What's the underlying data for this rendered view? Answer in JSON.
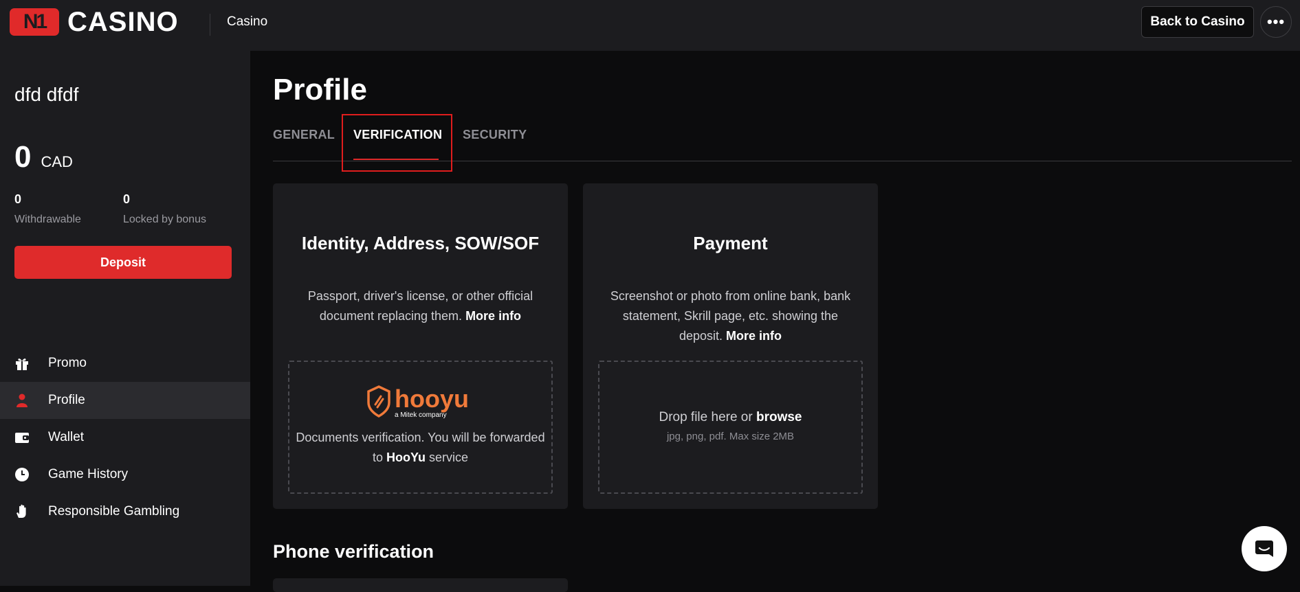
{
  "header": {
    "logo_mark": "N1",
    "logo_text": "CASINO",
    "section": "Casino",
    "back_label": "Back to Casino",
    "more_label": "•••"
  },
  "sidebar": {
    "user_name": "dfd dfdf",
    "balance": "0",
    "currency": "CAD",
    "withdrawable_value": "0",
    "withdrawable_label": "Withdrawable",
    "locked_value": "0",
    "locked_label": "Locked by bonus",
    "deposit_label": "Deposit",
    "nav": [
      {
        "label": "Promo",
        "icon": "gift-icon"
      },
      {
        "label": "Profile",
        "icon": "user-icon",
        "active": true
      },
      {
        "label": "Wallet",
        "icon": "wallet-icon"
      },
      {
        "label": "Game History",
        "icon": "clock-icon"
      },
      {
        "label": "Responsible Gambling",
        "icon": "hand-icon"
      }
    ]
  },
  "main": {
    "title": "Profile",
    "tabs": [
      {
        "label": "GENERAL"
      },
      {
        "label": "VERIFICATION",
        "active": true
      },
      {
        "label": "SECURITY"
      }
    ],
    "cards": [
      {
        "title": "Identity, Address, SOW/SOF",
        "desc": "Passport, driver's license, or other official document replacing them.",
        "more": "More info",
        "logo_word": "hooyu",
        "logo_sub": "a Mitek company",
        "dz_text": "Documents verification. You will be forwarded to",
        "dz_brand": "HooYu",
        "dz_after": "service"
      },
      {
        "title": "Payment",
        "desc": "Screenshot or photo from online bank, bank statement, Skrill page, etc. showing the deposit.",
        "more": "More info",
        "drop_text": "Drop file here or",
        "drop_link": "browse",
        "drop_hint": "jpg, png, pdf. Max size 2MB"
      }
    ],
    "phone_title": "Phone verification"
  },
  "colors": {
    "accent": "#df2b2b",
    "panel": "#1c1c1f",
    "background": "#0c0c0d"
  }
}
